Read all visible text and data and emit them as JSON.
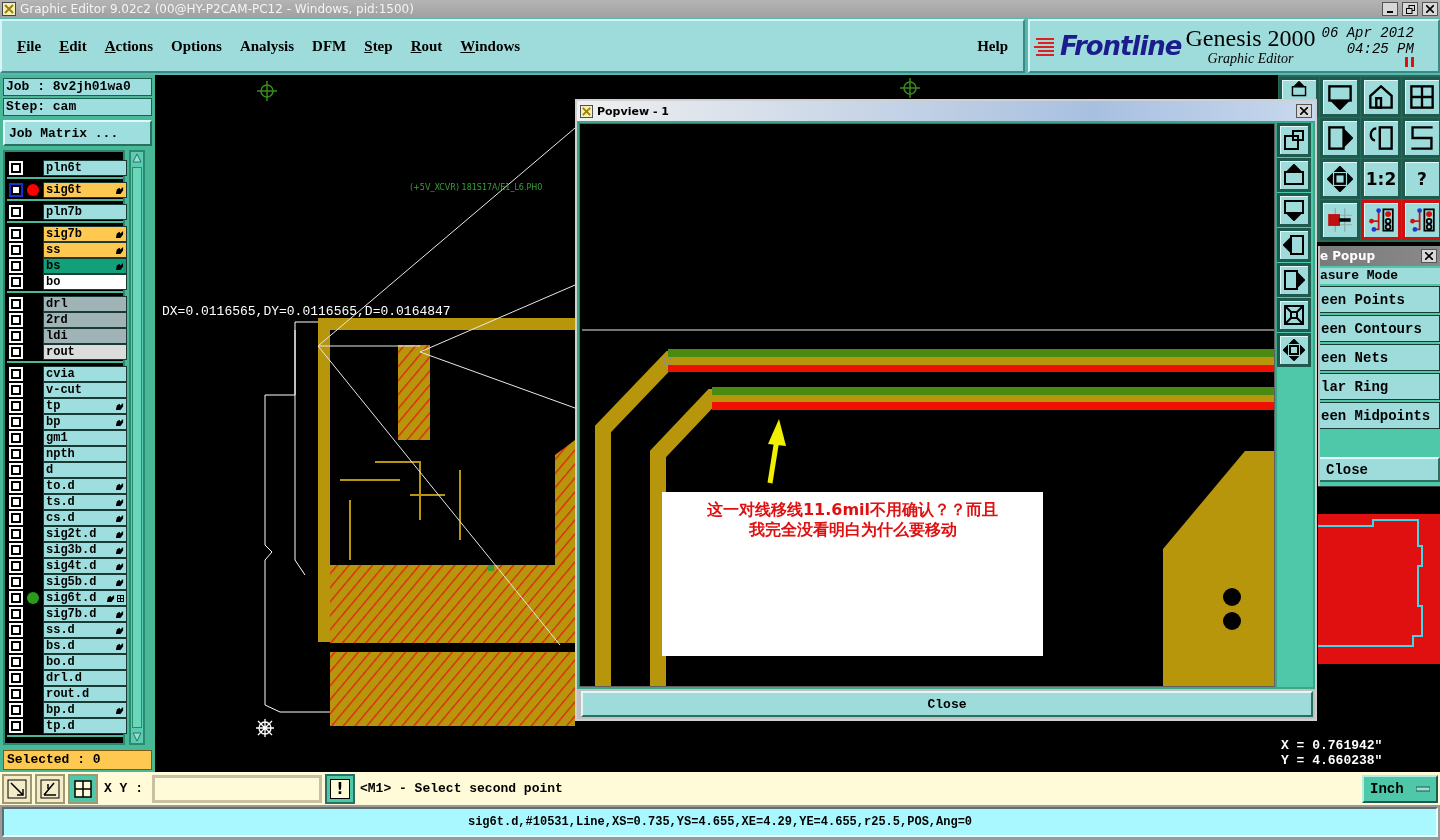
{
  "window": {
    "title": "Graphic Editor 9.02c2 (00@HY-P2CAM-PC12 - Windows, pid:1500)"
  },
  "menu": [
    {
      "label": "File",
      "mnemonic": true
    },
    {
      "label": "Edit",
      "mnemonic": true
    },
    {
      "label": "Actions",
      "mnemonic": true
    },
    {
      "label": "Options",
      "mnemonic": false
    },
    {
      "label": "Analysis",
      "mnemonic": false
    },
    {
      "label": "DFM",
      "mnemonic": false
    },
    {
      "label": "Step",
      "mnemonic": true
    },
    {
      "label": "Rout",
      "mnemonic": true
    },
    {
      "label": "Windows",
      "mnemonic": true
    }
  ],
  "help": "Help",
  "brand": {
    "logo": "Frontline",
    "product": "Genesis 2000",
    "module": "Graphic Editor",
    "date": "06 Apr 2012",
    "time": "04:25 PM"
  },
  "job": {
    "job": "Job : 8v2jh01wa0",
    "step": "Step: cam",
    "matrix_button": "Job Matrix ..."
  },
  "layer_groups": [
    {
      "layers": [
        {
          "name": "pln6t",
          "color": "#9edede",
          "hand": false,
          "grid": false,
          "selected": false
        }
      ]
    },
    {
      "layers": [
        {
          "name": "sig6t",
          "color": "#ffc850",
          "hand": true,
          "grid": false,
          "selected": true,
          "dot": {
            "color": "#ff0000"
          }
        }
      ]
    },
    {
      "layers": [
        {
          "name": "pln7b",
          "color": "#9edede",
          "hand": false,
          "grid": false,
          "selected": false
        }
      ]
    },
    {
      "layers": [
        {
          "name": "sig7b",
          "color": "#ffc850",
          "hand": true,
          "grid": false,
          "selected": false
        },
        {
          "name": "ss",
          "color": "#ffc850",
          "hand": true,
          "grid": false,
          "selected": false
        },
        {
          "name": "bs",
          "color": "#12a07a",
          "hand": true,
          "grid": false,
          "selected": false
        },
        {
          "name": "bo",
          "color": "#ffffff",
          "hand": false,
          "grid": false,
          "selected": false
        }
      ]
    },
    {
      "layers": [
        {
          "name": "drl",
          "color": "#a0b4b8",
          "hand": false,
          "grid": false,
          "selected": false
        },
        {
          "name": "2rd",
          "color": "#a0b4b8",
          "hand": false,
          "grid": false,
          "selected": false
        },
        {
          "name": "ldi",
          "color": "#a0b4b8",
          "hand": false,
          "grid": false,
          "selected": false
        },
        {
          "name": "rout",
          "color": "#dcdcdc",
          "hand": false,
          "grid": false,
          "selected": false
        }
      ]
    },
    {
      "layers": [
        {
          "name": "cvia",
          "color": "#9edede",
          "hand": false,
          "grid": false,
          "selected": false
        },
        {
          "name": "v-cut",
          "color": "#9edede",
          "hand": false,
          "grid": false,
          "selected": false
        },
        {
          "name": "tp",
          "color": "#9edede",
          "hand": true,
          "grid": false,
          "selected": false
        },
        {
          "name": "bp",
          "color": "#9edede",
          "hand": true,
          "grid": false,
          "selected": false
        },
        {
          "name": "gm1",
          "color": "#9edede",
          "hand": false,
          "grid": false,
          "selected": false
        },
        {
          "name": "npth",
          "color": "#9edede",
          "hand": false,
          "grid": false,
          "selected": false
        },
        {
          "name": "d",
          "color": "#9edede",
          "hand": false,
          "grid": false,
          "selected": false
        },
        {
          "name": "to.d",
          "color": "#9edede",
          "hand": true,
          "grid": false,
          "selected": false
        },
        {
          "name": "ts.d",
          "color": "#9edede",
          "hand": true,
          "grid": false,
          "selected": false
        },
        {
          "name": "cs.d",
          "color": "#9edede",
          "hand": true,
          "grid": false,
          "selected": false
        },
        {
          "name": "sig2t.d",
          "color": "#9edede",
          "hand": true,
          "grid": false,
          "selected": false
        },
        {
          "name": "sig3b.d",
          "color": "#9edede",
          "hand": true,
          "grid": false,
          "selected": false
        },
        {
          "name": "sig4t.d",
          "color": "#9edede",
          "hand": true,
          "grid": false,
          "selected": false
        },
        {
          "name": "sig5b.d",
          "color": "#9edede",
          "hand": true,
          "grid": false,
          "selected": false
        },
        {
          "name": "sig6t.d",
          "color": "#9edede",
          "hand": true,
          "grid": true,
          "selected": false,
          "dot": {
            "color": "#2a9a1a"
          }
        },
        {
          "name": "sig7b.d",
          "color": "#9edede",
          "hand": true,
          "grid": false,
          "selected": false
        },
        {
          "name": "ss.d",
          "color": "#9edede",
          "hand": true,
          "grid": false,
          "selected": false
        },
        {
          "name": "bs.d",
          "color": "#9edede",
          "hand": true,
          "grid": false,
          "selected": false
        },
        {
          "name": "bo.d",
          "color": "#9edede",
          "hand": false,
          "grid": false,
          "selected": false
        },
        {
          "name": "drl.d",
          "color": "#9edede",
          "hand": false,
          "grid": false,
          "selected": false
        },
        {
          "name": "rout.d",
          "color": "#9edede",
          "hand": false,
          "grid": false,
          "selected": false
        },
        {
          "name": "bp.d",
          "color": "#9edede",
          "hand": true,
          "grid": false,
          "selected": false
        },
        {
          "name": "tp.d",
          "color": "#9edede",
          "hand": false,
          "grid": false,
          "selected": false
        }
      ]
    }
  ],
  "selected_count": "Selected : 0",
  "canvas": {
    "measurement": "DX=0.0116565,DY=0.0116565,D=0.0164847",
    "net_label": "(+5V_XCVR) 181S17A/E1_L6.PH0"
  },
  "popview": {
    "title": "Popview - 1",
    "note": "这一对线移线11.6mil不用确认？？而且我完全没看明白为什么要移动",
    "close": "Close"
  },
  "toolbar": [
    {
      "kind": "box-up",
      "active": false
    },
    {
      "kind": "box-down",
      "active": false
    },
    {
      "kind": "house",
      "active": false
    },
    {
      "kind": "grid-xy",
      "active": false
    },
    {
      "kind": "box-right",
      "active": false
    },
    {
      "kind": "undo",
      "active": false
    },
    {
      "kind": "s-curve",
      "active": false
    },
    {
      "kind": "pan",
      "active": false
    },
    {
      "kind": "text",
      "label": "1:2",
      "active": false
    },
    {
      "kind": "text",
      "label": "?",
      "active": false
    },
    {
      "kind": "snap",
      "active": false
    },
    {
      "kind": "circuit",
      "active": true
    },
    {
      "kind": "circuit",
      "active": true
    }
  ],
  "measure_popup": {
    "title": "e Popup",
    "mode": "asure Mode",
    "items": [
      "een Points",
      "een Contours",
      "een Nets",
      "lar Ring",
      "een Midpoints"
    ],
    "close": "Close"
  },
  "coordinates": {
    "x": "X = 0.761942\"",
    "y": "Y = 4.660238\""
  },
  "command_bar": {
    "xy_label": "X Y :",
    "execute": "!",
    "prompt": "<M1> - Select second point",
    "units": "Inch"
  },
  "status_bar": "sig6t.d,#10531,Line,XS=0.735,YS=4.655,XE=4.29,YE=4.655,r25.5,POS,Ang=0"
}
